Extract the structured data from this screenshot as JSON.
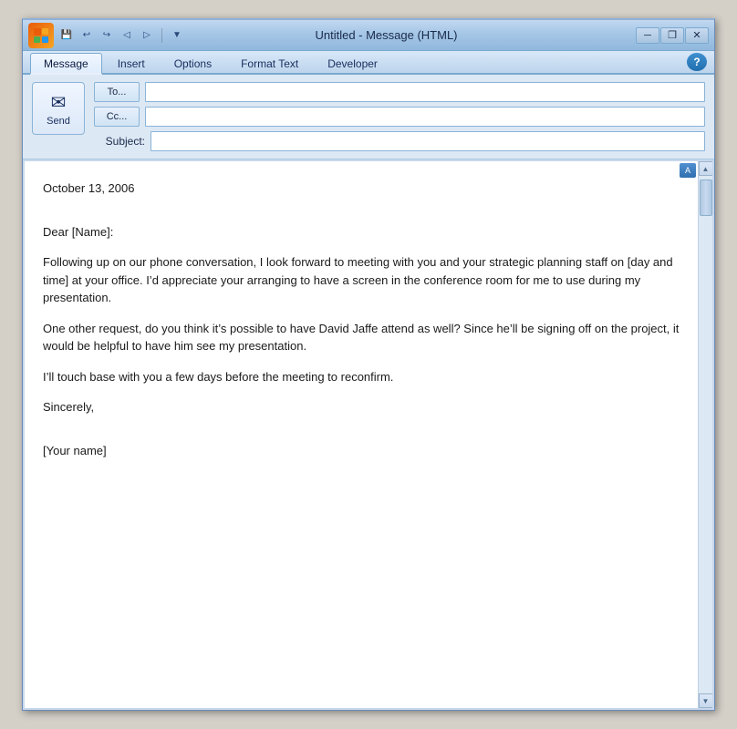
{
  "window": {
    "title": "Untitled - Message (HTML)",
    "title_left": "Untitled",
    "title_right": "Message (HTML)"
  },
  "titlebar": {
    "logo_text": "W",
    "quick_access": {
      "save_tooltip": "Save",
      "undo_tooltip": "Undo",
      "redo_tooltip": "Redo",
      "back_tooltip": "Back",
      "forward_tooltip": "Forward",
      "dropdown_tooltip": "Customize Quick Access Toolbar"
    },
    "controls": {
      "minimize": "─",
      "restore": "❐",
      "close": "✕"
    }
  },
  "ribbon": {
    "tabs": [
      {
        "id": "message",
        "label": "Message",
        "active": true
      },
      {
        "id": "insert",
        "label": "Insert",
        "active": false
      },
      {
        "id": "options",
        "label": "Options",
        "active": false
      },
      {
        "id": "format_text",
        "label": "Format Text",
        "active": false
      },
      {
        "id": "developer",
        "label": "Developer",
        "active": false
      }
    ],
    "help_tooltip": "?"
  },
  "email_header": {
    "send_button_label": "Send",
    "to_button_label": "To...",
    "cc_button_label": "Cc...",
    "subject_label": "Subject:",
    "to_value": "",
    "cc_value": "",
    "subject_value": ""
  },
  "email_body": {
    "paragraphs": [
      "October 13, 2006",
      "Dear [Name]:",
      "Following up on our phone conversation, I look forward to meeting with you and your strategic planning staff on [day and time] at your office. I’d appreciate your arranging to have a screen in the conference room for me to use during my presentation.",
      "One other request, do you think it’s possible to have David Jaffe attend as well? Since he’ll be signing off on the project, it would be helpful to have him see my presentation.",
      "I’ll touch base with you a few days before the meeting to reconfirm.",
      "Sincerely,",
      "[Your name]"
    ]
  }
}
